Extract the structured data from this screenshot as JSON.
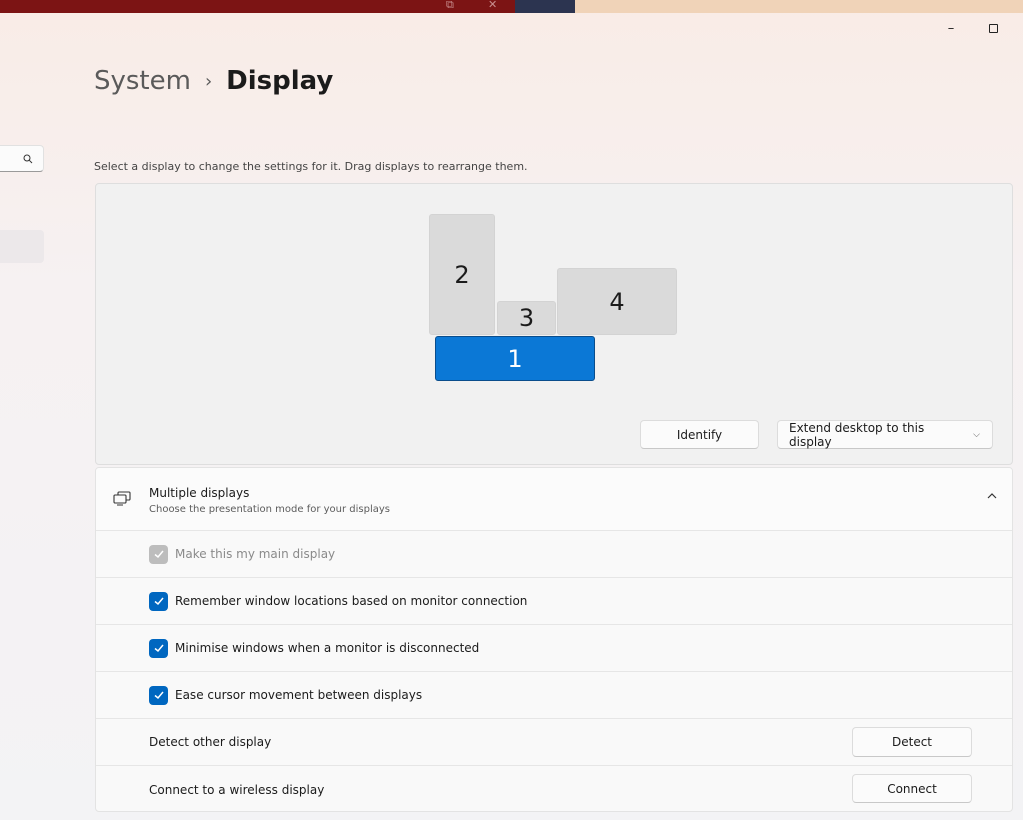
{
  "window": {
    "minimize_glyph": "–",
    "ghost_icons": [
      "⧉",
      "✕"
    ]
  },
  "breadcrumb": {
    "parent": "System",
    "separator": "›",
    "current": "Display"
  },
  "sidebar": {
    "search_icon": "search-icon"
  },
  "arrangement": {
    "hint": "Select a display to change the settings for it. Drag displays to rearrange them.",
    "monitors": [
      {
        "label": "2",
        "selected": false
      },
      {
        "label": "3",
        "selected": false
      },
      {
        "label": "4",
        "selected": false
      },
      {
        "label": "1",
        "selected": true
      }
    ],
    "identify_label": "Identify",
    "extend_label": "Extend desktop to this display"
  },
  "multiple_displays": {
    "title": "Multiple displays",
    "subtitle": "Choose the presentation mode for your displays",
    "options": [
      {
        "label": "Make this my main display",
        "checked": true,
        "disabled": true
      },
      {
        "label": "Remember window locations based on monitor connection",
        "checked": true,
        "disabled": false
      },
      {
        "label": "Minimise windows when a monitor is disconnected",
        "checked": true,
        "disabled": false
      },
      {
        "label": "Ease cursor movement between displays",
        "checked": true,
        "disabled": false
      }
    ],
    "detect": {
      "label": "Detect other display",
      "button": "Detect"
    },
    "connect": {
      "label": "Connect to a wireless display",
      "button": "Connect"
    }
  },
  "colors": {
    "accent": "#0067c0",
    "selected_monitor": "#0b78d6",
    "titlebar_bg": "#7c1414"
  }
}
